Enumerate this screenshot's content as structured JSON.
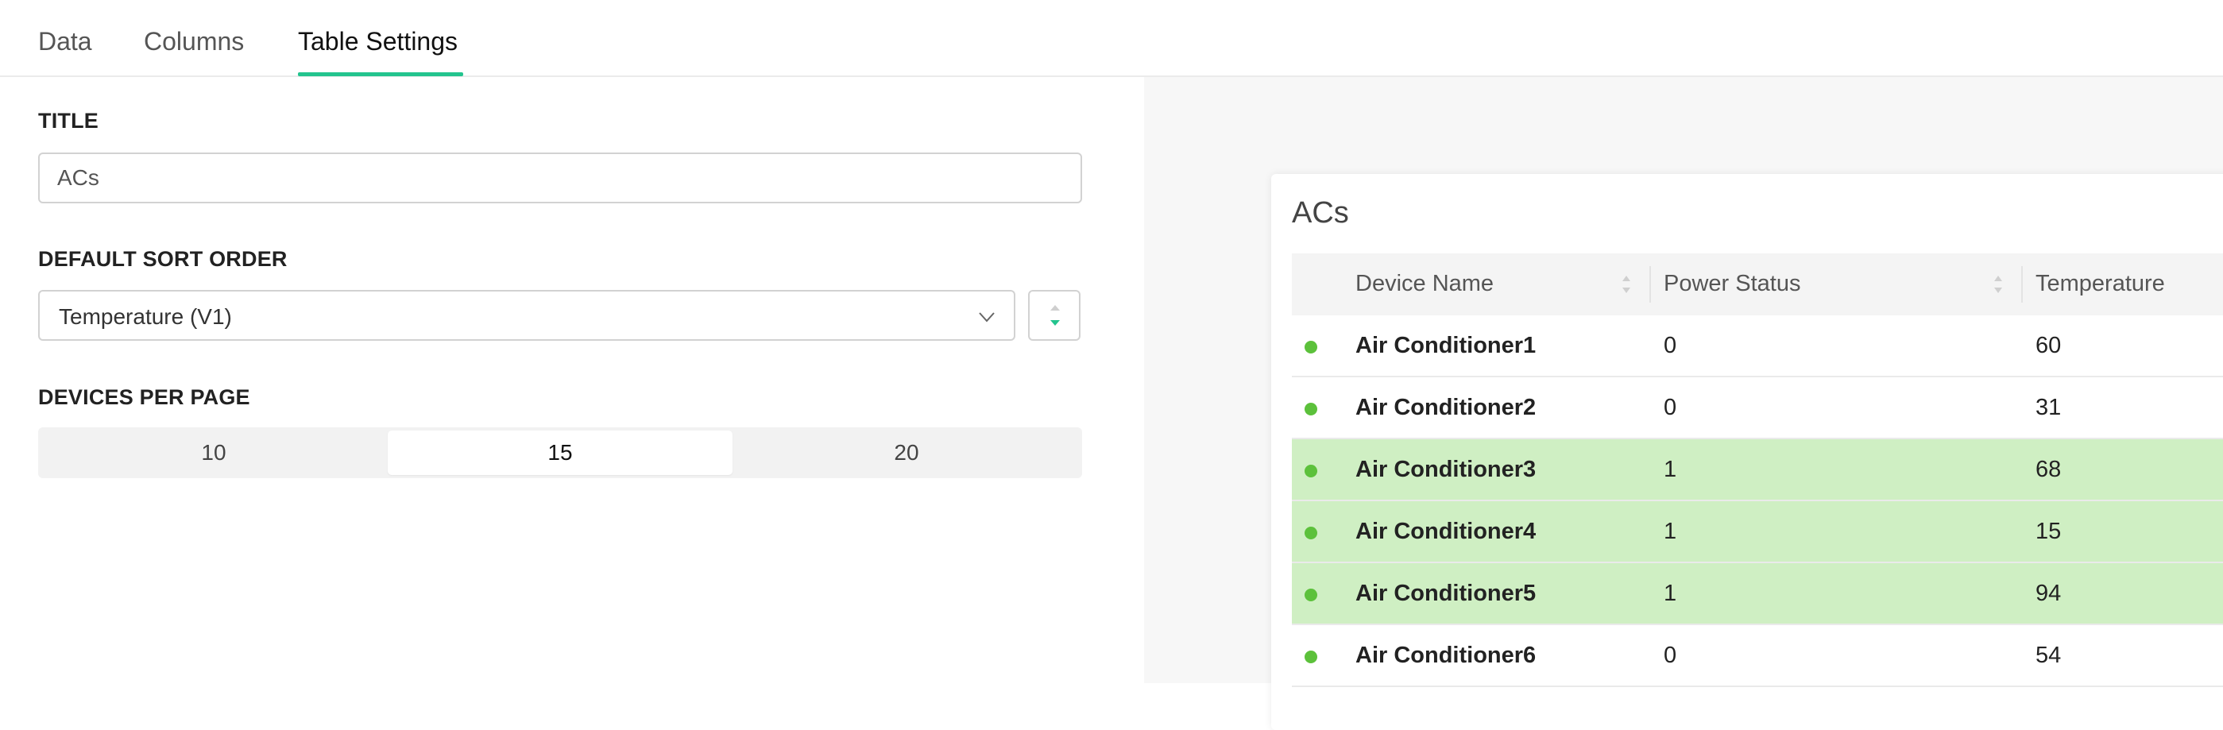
{
  "tabs": [
    {
      "label": "Data",
      "active": false
    },
    {
      "label": "Columns",
      "active": false
    },
    {
      "label": "Table Settings",
      "active": true
    }
  ],
  "settings": {
    "title_label": "TITLE",
    "title_value": "ACs",
    "sort_label": "DEFAULT SORT ORDER",
    "sort_value": "Temperature (V1)",
    "sort_direction": "descending",
    "devices_label": "DEVICES PER PAGE",
    "devices_options": [
      "10",
      "15",
      "20"
    ],
    "devices_selected": "15"
  },
  "preview": {
    "title": "ACs",
    "columns": [
      "Device Name",
      "Power Status",
      "Temperature"
    ],
    "rows": [
      {
        "name": "Air Conditioner1",
        "power": "0",
        "temp": "60",
        "highlight": false
      },
      {
        "name": "Air Conditioner2",
        "power": "0",
        "temp": "31",
        "highlight": false
      },
      {
        "name": "Air Conditioner3",
        "power": "1",
        "temp": "68",
        "highlight": true
      },
      {
        "name": "Air Conditioner4",
        "power": "1",
        "temp": "15",
        "highlight": true
      },
      {
        "name": "Air Conditioner5",
        "power": "1",
        "temp": "94",
        "highlight": true
      },
      {
        "name": "Air Conditioner6",
        "power": "0",
        "temp": "54",
        "highlight": false
      }
    ]
  },
  "colors": {
    "accent": "#23c48e",
    "status_online": "#5cc13b",
    "row_highlight": "#cfefc3"
  },
  "icons": {
    "select": "chevron-down-icon",
    "sort_direction": "sort-descending-icon",
    "column_sort": "sort-icon",
    "row_status": "status-dot"
  }
}
